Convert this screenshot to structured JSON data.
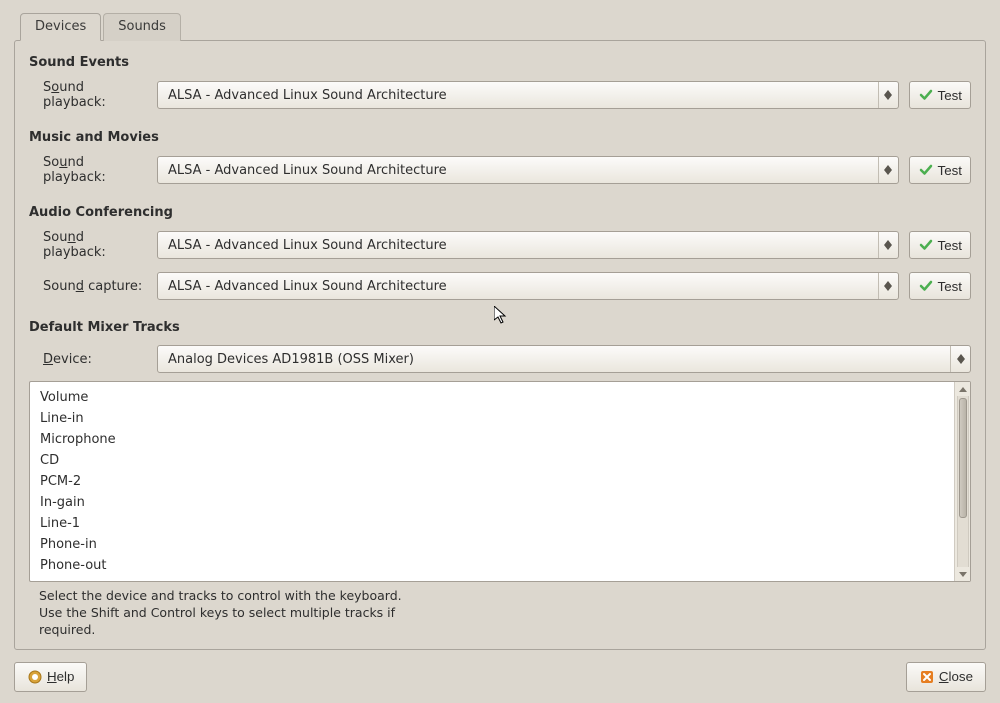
{
  "tabs": {
    "devices": "Devices",
    "sounds": "Sounds"
  },
  "sound_events": {
    "title": "Sound Events",
    "playback_label_pre": "S",
    "playback_label_u": "o",
    "playback_label_post": "und playback:",
    "playback_value": "ALSA - Advanced Linux Sound Architecture",
    "test_label": "Test"
  },
  "music_movies": {
    "title": "Music and Movies",
    "playback_label_pre": "So",
    "playback_label_u": "u",
    "playback_label_post": "nd playback:",
    "playback_value": "ALSA - Advanced Linux Sound Architecture",
    "test_label": "Test"
  },
  "conferencing": {
    "title": "Audio Conferencing",
    "playback_label_pre": "Sou",
    "playback_label_u": "n",
    "playback_label_post": "d playback:",
    "playback_value": "ALSA - Advanced Linux Sound Architecture",
    "capture_label_pre": "Soun",
    "capture_label_u": "d",
    "capture_label_post": " capture:",
    "capture_value": "ALSA - Advanced Linux Sound Architecture",
    "test_label": "Test"
  },
  "mixer": {
    "title": "Default Mixer Tracks",
    "device_label_u": "D",
    "device_label_post": "evice:",
    "device_value": "Analog Devices AD1981B (OSS Mixer)",
    "tracks": [
      "Volume",
      "Line-in",
      "Microphone",
      "CD",
      "PCM-2",
      "In-gain",
      "Line-1",
      "Phone-in",
      "Phone-out"
    ],
    "hint1": "Select the device and tracks to control with the keyboard.",
    "hint2": "Use the Shift and Control keys to select multiple tracks if",
    "hint3": "required."
  },
  "footer": {
    "help_u": "H",
    "help_post": "elp",
    "close_u": "C",
    "close_post": "lose"
  }
}
